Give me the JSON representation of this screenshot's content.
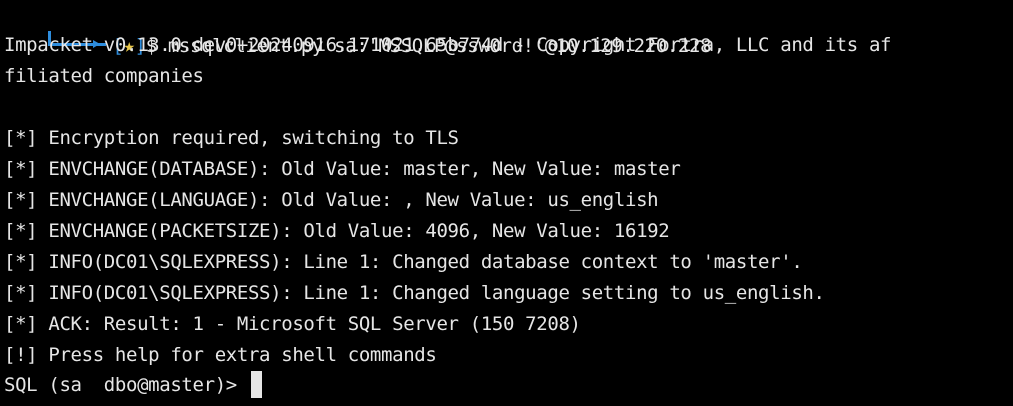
{
  "colors": {
    "background": "#000000",
    "text": "#e6e6e6",
    "prompt_accent": "#2e8ddd",
    "prompt_star": "#e5c54a"
  },
  "prompt": {
    "bracket_open": "[",
    "star": "★",
    "bracket_close": "]",
    "suffix": "$ ",
    "command": "mssqlclient.py sa:'MSSQLP@ssw0rd!'@10.129.220.228"
  },
  "output": {
    "banner_line1": "Impacket v0.13.0.dev0+20240916.171021.65b774d - Copyright Fortra, LLC and its af",
    "banner_line2": "filiated companies",
    "blank": "",
    "lines": [
      "[*] Encryption required, switching to TLS",
      "[*] ENVCHANGE(DATABASE): Old Value: master, New Value: master",
      "[*] ENVCHANGE(LANGUAGE): Old Value: , New Value: us_english",
      "[*] ENVCHANGE(PACKETSIZE): Old Value: 4096, New Value: 16192",
      "[*] INFO(DC01\\SQLEXPRESS): Line 1: Changed database context to 'master'.",
      "[*] INFO(DC01\\SQLEXPRESS): Line 1: Changed language setting to us_english.",
      "[*] ACK: Result: 1 - Microsoft SQL Server (150 7208)",
      "[!] Press help for extra shell commands"
    ]
  },
  "sql_prompt": "SQL (sa  dbo@master)> "
}
